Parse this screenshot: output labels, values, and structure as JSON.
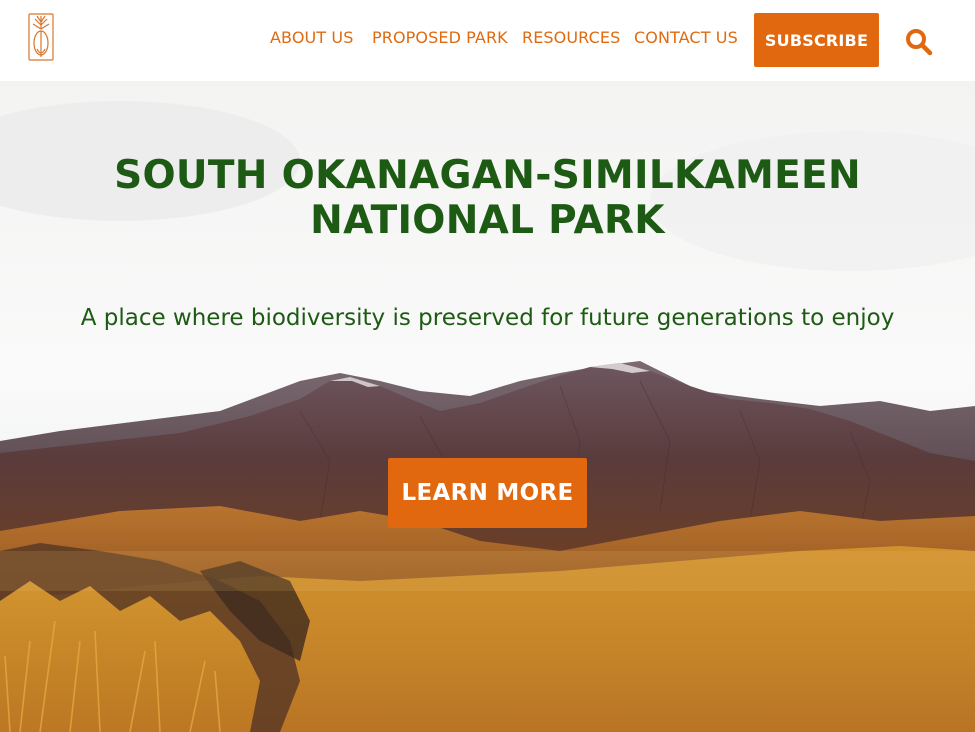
{
  "header": {
    "logo_icon": "tree-person-logo-icon",
    "nav": [
      {
        "label": "ABOUT US"
      },
      {
        "label": "PROPOSED PARK"
      },
      {
        "label": "RESOURCES"
      },
      {
        "label": "CONTACT US"
      }
    ],
    "subscribe_label": "SUBSCRIBE",
    "search_icon": "search-icon"
  },
  "hero": {
    "title_line1": "SOUTH OKANAGAN-SIMILKAMEEN",
    "title_line2": "NATIONAL PARK",
    "subtitle": "A place where biodiversity is preserved for future generations to enjoy",
    "cta_label": "LEARN MORE"
  },
  "colors": {
    "accent": "#e2680f",
    "title_green": "#1d5a14",
    "header_bg": "#ffffff"
  }
}
